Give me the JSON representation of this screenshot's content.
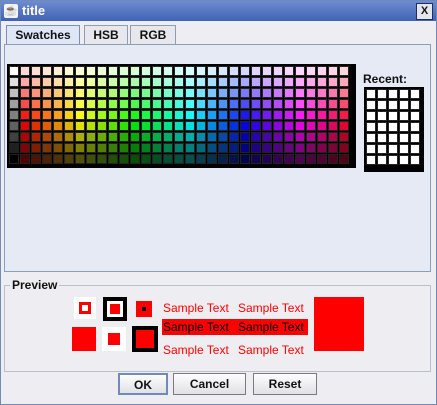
{
  "window": {
    "title": "title",
    "close_label": "X"
  },
  "tabs": [
    {
      "label": "Swatches",
      "active": true
    },
    {
      "label": "HSB",
      "active": false
    },
    {
      "label": "RGB",
      "active": false
    }
  ],
  "swatches": {
    "columns": 31,
    "rows": 9
  },
  "recent": {
    "label": "Recent:",
    "columns": 5,
    "rows": 7,
    "color": "#ffffff"
  },
  "preview": {
    "label": "Preview",
    "sample_text": [
      "Sample Text",
      "Sample Text",
      "Sample Text",
      "Sample Text",
      "Sample Text",
      "Sample Text"
    ],
    "color": "#ff0000"
  },
  "buttons": {
    "ok": "OK",
    "cancel": "Cancel",
    "reset": "Reset"
  },
  "colors": {
    "title_bar": "#3f63b4",
    "preview_red": "#ff0000",
    "grid_border": "#000000"
  }
}
